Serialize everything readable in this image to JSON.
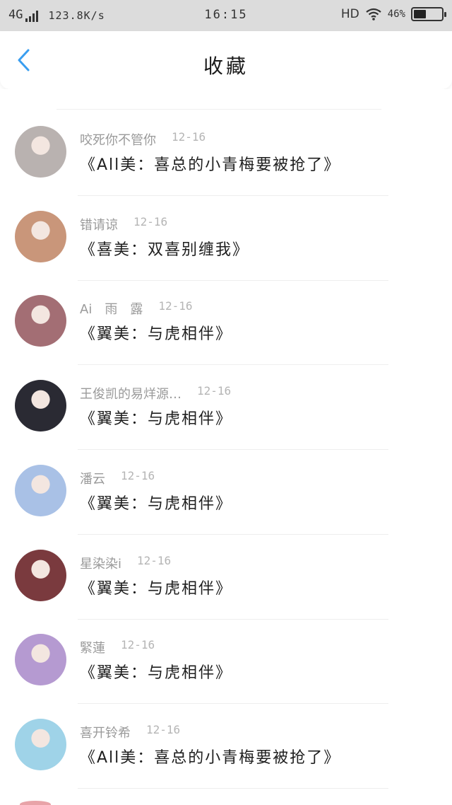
{
  "status_bar": {
    "network": "4G",
    "speed": "123.8K/s",
    "time": "16:15",
    "hd": "HD",
    "battery": "46%",
    "battery_level": 0.46
  },
  "header": {
    "title": "收藏",
    "back_icon": "chevron-left-icon"
  },
  "favorites": [
    {
      "name": "咬死你不管你",
      "date": "12-16",
      "title": "《All美：喜总的小青梅要被抢了》",
      "avatar_color": "#b9b2b0"
    },
    {
      "name": "错请谅",
      "date": "12-16",
      "title": "《喜美：双喜别缠我》",
      "avatar_color": "#c9967a"
    },
    {
      "name": "Ai　雨　露",
      "date": "12-16",
      "title": "《翼美：与虎相伴》",
      "avatar_color": "#a36e74"
    },
    {
      "name": "王俊凯的易烊源…",
      "date": "12-16",
      "title": "《翼美：与虎相伴》",
      "avatar_color": "#2a2a33"
    },
    {
      "name": "潘云",
      "date": "12-16",
      "title": "《翼美：与虎相伴》",
      "avatar_color": "#a9c1e6"
    },
    {
      "name": "星染染i",
      "date": "12-16",
      "title": "《翼美：与虎相伴》",
      "avatar_color": "#7a3a3e"
    },
    {
      "name": "緊蓮",
      "date": "12-16",
      "title": "《翼美：与虎相伴》",
      "avatar_color": "#b59ad1"
    },
    {
      "name": "喜开铃希",
      "date": "12-16",
      "title": "《All美：喜总的小青梅要被抢了》",
      "avatar_color": "#9fd3e8"
    }
  ]
}
